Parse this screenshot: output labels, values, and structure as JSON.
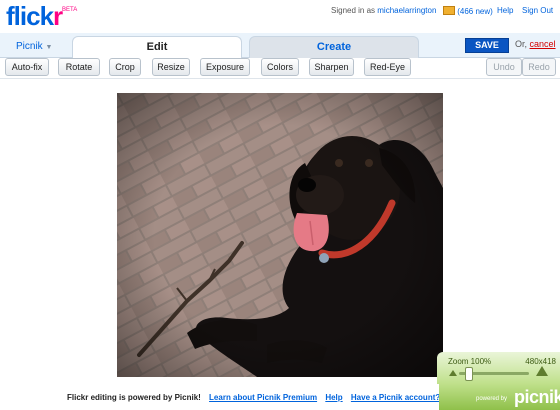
{
  "header": {
    "logo": {
      "text_main": "flick",
      "text_accent": "r",
      "beta": "BETA"
    },
    "signed_in_prefix": "Signed in as",
    "username": "michaelarrington",
    "mail_count": "(466 new)",
    "help": "Help",
    "sign_out": "Sign Out"
  },
  "tabbar": {
    "picnik_menu": "Picnik",
    "tabs": [
      {
        "label": "Edit",
        "active": true
      },
      {
        "label": "Create",
        "active": false
      }
    ],
    "save": "SAVE",
    "or": "Or,",
    "cancel": "cancel"
  },
  "toolbar": {
    "buttons": [
      "Auto-fix",
      "Rotate",
      "Crop",
      "Resize",
      "Exposure",
      "Colors",
      "Sharpen",
      "Red-Eye"
    ],
    "undo": "Undo",
    "redo": "Redo"
  },
  "zoom": {
    "label": "Zoom 100%",
    "dimensions": "480x418",
    "slider_level": 0.1
  },
  "footer": {
    "text": "Flickr editing is powered by Picnik!",
    "links": [
      "Learn about Picnik Premium",
      "Help",
      "Have a Picnik account?"
    ],
    "powered_by": "powered by",
    "brand": "picnik"
  },
  "colors": {
    "flickr_blue": "#0063dc",
    "flickr_pink": "#ff0084",
    "save_blue": "#0a55c2",
    "picnik_green": "#8fc04a"
  }
}
